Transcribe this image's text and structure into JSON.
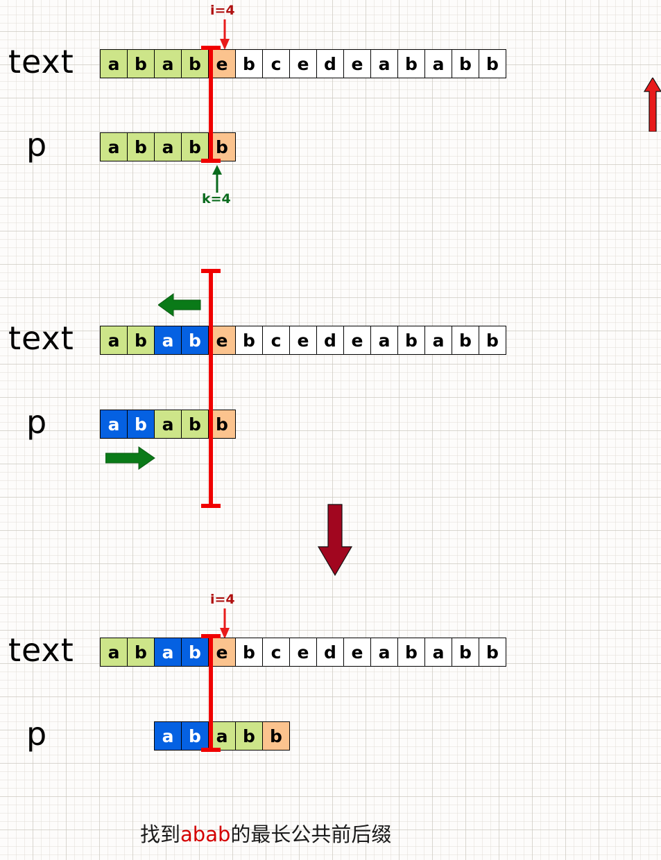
{
  "diagram": {
    "title": "KMP pattern matching - longest common prefix-suffix shift",
    "colors": {
      "green": "#cde589",
      "blue": "#0561e2",
      "orange": "#fbc38e",
      "white": "#ffffff",
      "marker_red": "#f00000",
      "label_red": "#b01010",
      "label_green": "#0a6b1e",
      "arrow_green": "#0a7a18",
      "arrow_dark_red": "#a1061f",
      "arrow_bright_red": "#e81b1b",
      "caption_highlight": "#d40000"
    },
    "labels": {
      "text_row": "text",
      "pattern_row": "p"
    },
    "strings": {
      "text": "ababebcedeababb",
      "pattern": "ababb"
    }
  },
  "sections": [
    {
      "id": "step-1",
      "text_row": {
        "label": "text",
        "cells": [
          {
            "ch": "a",
            "fill": "green"
          },
          {
            "ch": "b",
            "fill": "green"
          },
          {
            "ch": "a",
            "fill": "green"
          },
          {
            "ch": "b",
            "fill": "green"
          },
          {
            "ch": "e",
            "fill": "orange"
          },
          {
            "ch": "b",
            "fill": "plain"
          },
          {
            "ch": "c",
            "fill": "plain"
          },
          {
            "ch": "e",
            "fill": "plain"
          },
          {
            "ch": "d",
            "fill": "plain"
          },
          {
            "ch": "e",
            "fill": "plain"
          },
          {
            "ch": "a",
            "fill": "plain"
          },
          {
            "ch": "b",
            "fill": "plain"
          },
          {
            "ch": "a",
            "fill": "plain"
          },
          {
            "ch": "b",
            "fill": "plain"
          },
          {
            "ch": "b",
            "fill": "plain"
          }
        ]
      },
      "pattern_row": {
        "label": "p",
        "cells": [
          {
            "ch": "a",
            "fill": "green"
          },
          {
            "ch": "b",
            "fill": "green"
          },
          {
            "ch": "a",
            "fill": "green"
          },
          {
            "ch": "b",
            "fill": "green"
          },
          {
            "ch": "b",
            "fill": "orange"
          }
        ]
      },
      "pointers": [
        {
          "name": "i",
          "label": "i=4",
          "color": "red",
          "direction": "down"
        },
        {
          "name": "k",
          "label": "k=4",
          "color": "green",
          "direction": "up"
        }
      ]
    },
    {
      "id": "step-2",
      "text_row": {
        "label": "text",
        "cells": [
          {
            "ch": "a",
            "fill": "green"
          },
          {
            "ch": "b",
            "fill": "green"
          },
          {
            "ch": "a",
            "fill": "blue"
          },
          {
            "ch": "b",
            "fill": "blue"
          },
          {
            "ch": "e",
            "fill": "orange"
          },
          {
            "ch": "b",
            "fill": "plain"
          },
          {
            "ch": "c",
            "fill": "plain"
          },
          {
            "ch": "e",
            "fill": "plain"
          },
          {
            "ch": "d",
            "fill": "plain"
          },
          {
            "ch": "e",
            "fill": "plain"
          },
          {
            "ch": "a",
            "fill": "plain"
          },
          {
            "ch": "b",
            "fill": "plain"
          },
          {
            "ch": "a",
            "fill": "plain"
          },
          {
            "ch": "b",
            "fill": "plain"
          },
          {
            "ch": "b",
            "fill": "plain"
          }
        ]
      },
      "pattern_row": {
        "label": "p",
        "cells": [
          {
            "ch": "a",
            "fill": "blue"
          },
          {
            "ch": "b",
            "fill": "blue"
          },
          {
            "ch": "a",
            "fill": "green"
          },
          {
            "ch": "b",
            "fill": "green"
          },
          {
            "ch": "b",
            "fill": "orange"
          }
        ]
      },
      "arrows": [
        {
          "name": "suffix-arrow",
          "direction": "left",
          "color": "green"
        },
        {
          "name": "prefix-arrow",
          "direction": "right",
          "color": "green"
        }
      ]
    },
    {
      "id": "step-3",
      "text_row": {
        "label": "text",
        "cells": [
          {
            "ch": "a",
            "fill": "green"
          },
          {
            "ch": "b",
            "fill": "green"
          },
          {
            "ch": "a",
            "fill": "blue"
          },
          {
            "ch": "b",
            "fill": "blue"
          },
          {
            "ch": "e",
            "fill": "orange"
          },
          {
            "ch": "b",
            "fill": "plain"
          },
          {
            "ch": "c",
            "fill": "plain"
          },
          {
            "ch": "e",
            "fill": "plain"
          },
          {
            "ch": "d",
            "fill": "plain"
          },
          {
            "ch": "e",
            "fill": "plain"
          },
          {
            "ch": "a",
            "fill": "plain"
          },
          {
            "ch": "b",
            "fill": "plain"
          },
          {
            "ch": "a",
            "fill": "plain"
          },
          {
            "ch": "b",
            "fill": "plain"
          },
          {
            "ch": "b",
            "fill": "plain"
          }
        ]
      },
      "pattern_row": {
        "label": "p",
        "shift_cells": 2,
        "cells": [
          {
            "ch": "a",
            "fill": "blue"
          },
          {
            "ch": "b",
            "fill": "blue"
          },
          {
            "ch": "a",
            "fill": "green"
          },
          {
            "ch": "b",
            "fill": "green"
          },
          {
            "ch": "b",
            "fill": "orange"
          }
        ]
      },
      "pointers": [
        {
          "name": "i",
          "label": "i=4",
          "color": "red",
          "direction": "down"
        }
      ]
    }
  ],
  "annotations": {
    "flow_arrow_down": {
      "name": "flow-arrow-down",
      "color": "#a1061f"
    },
    "flow_arrow_up": {
      "name": "flow-arrow-up",
      "color": "#e81b1b"
    }
  },
  "caption": {
    "prefix": "找到",
    "highlight": "abab",
    "suffix": "的最长公共前后缀"
  }
}
